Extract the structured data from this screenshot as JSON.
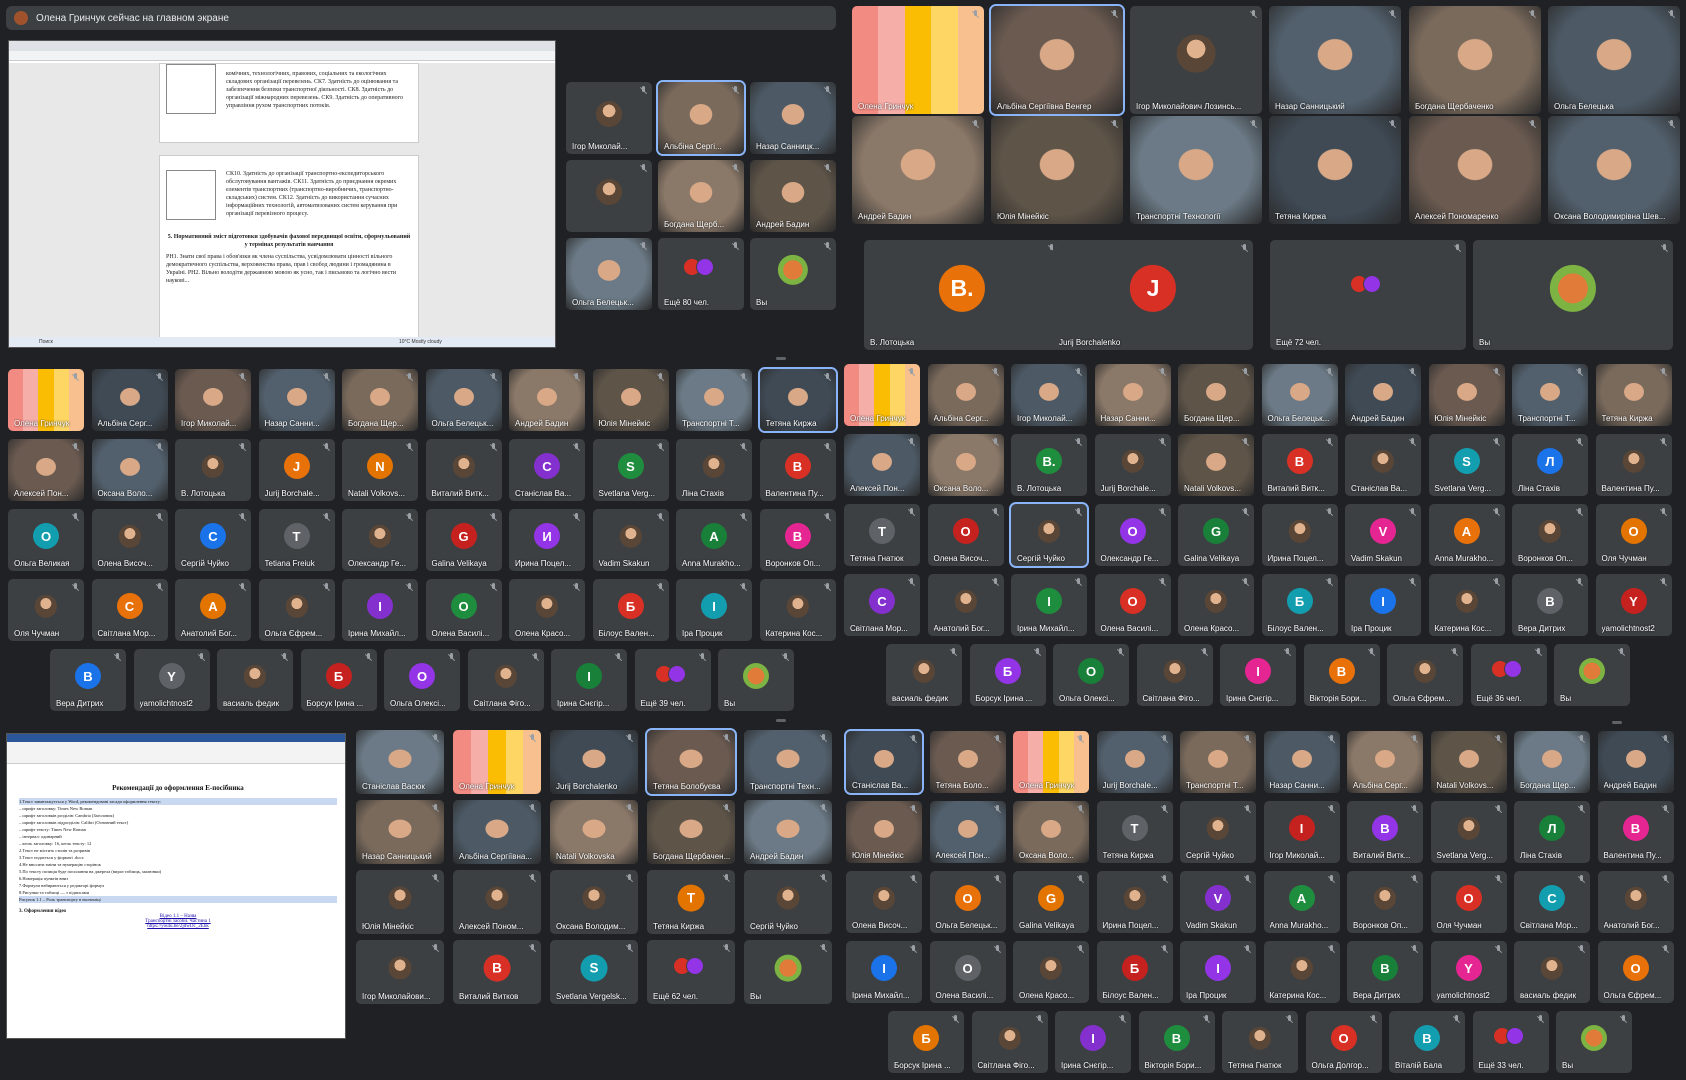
{
  "banner": {
    "text": "Олена Гринчук сейчас на главном экране"
  },
  "doc1": {
    "para1": "комічних, технологічних, правових, соціальних та екологічних складових організації перевезень. СК7. Здатність до оцінювання та забезпечення безпеки транспортної діяльності. СК8. Здатність до організації міжнародних перевезень. СК9. Здатність до оперативного управління рухом транспортних потоків.",
    "para2": "СК10. Здатність до організації транспортно-експедиторського обслуговування вантажів. СК11. Здатність до приєднання окремих елементів транспортних (транспортно-виробничих, транспортно-складських) систем. СК12. Здатність до використання сучасних інформаційних технологій, автоматизованих систем керування при організації перевізного процесу.",
    "heading": "5. Нормативний зміст підготовки здобувачів фахової передвищої освіти, сформульований у термінах результатів навчання",
    "para3": "РН1. Знати свої права і обов'язки як члена суспільства, усвідомлювати цінності вільного демократичного суспільства, верховенства права, прав і свобод людини і громадянина в Україні. РН2. Вільно володіти державною мовою як усно, так і письмово та логічно вести наукові...",
    "tab_label": "Ssfsdf",
    "search_placeholder": "Поиск",
    "weather": "10°C Mostly cloudy"
  },
  "doc2": {
    "title": "Рекомендації до оформлення Е-посібника",
    "lines": [
      "1.Текст завантажується у Word, рекомендовані засади оформлення тексту:",
      "– шрифт заголовку: Times New Roman",
      "– шрифт заголовків розділів: Cambria (Заголовок)",
      "– шрифт заголовків підрозділів: Calibri (Основний текст)",
      "– шрифт тексту: Times New Roman",
      "– інтервал: одинарний",
      "– кегль заголовку: 16, кегль тексту: 12",
      "2.Текст не містить стилів та розривів",
      "3.Текст подається у форматі .docx",
      "4.Не вносити зміни та нумерацію сторінок",
      "5.По тексту позиція буде посилання на джерела (вираз таблиць, малюнки)",
      "6.Номерація пунктів вниз",
      "7.Формули набираються у редакторі формул",
      "8.Рисунки та таблиці — з підписами",
      "Рисунок 1.1 – Роль транспорту в економіці"
    ],
    "footer_line": "3. Оформлення відео",
    "links": [
      "Відео 1.1 – Назва",
      "Транспортні засоби. Частина 1",
      "https://youtu.be/2jdwDc_2Ehk"
    ]
  },
  "grid_top_right": {
    "tiles": [
      "Олена Гринчук",
      "Альбіна Сергіївна Венгер",
      "Ігор Миколайович Лозинсь...",
      "Назар Санницький",
      "Богдана Щербаченко",
      "Ольга Белецька",
      "Андрей Бадин",
      "Юлія Мінейкіс",
      "Транспортні Технології",
      "Тетяна Киржа",
      "Алексей Пономаренко",
      "Оксана Володимирівна Шев...",
      "В. Лотоцька",
      "Jurij Borchalenko",
      "Ещё 72 чел.",
      "Вы"
    ],
    "letters": [
      "В.",
      "J",
      "В"
    ]
  },
  "grid_mid_small": {
    "tiles": [
      "Ігор Миколай...",
      "Альбіна Сергі...",
      "Назар Санницк...",
      "Богдана Щерб...",
      "Андрей Бадин",
      "Ольга Белецьк...",
      "Ещё 80 чел.",
      "Вы"
    ]
  },
  "grid_mid_left": {
    "rows": [
      [
        "Олена Гринчук",
        "Альбіна Серг...",
        "Ігор Миколай...",
        "Назар Санни...",
        "Богдана Щер...",
        "Ольга Белецьк...",
        "Андрей Бадин",
        "Юлія Мінейкіс",
        "Транспортні Т...",
        "Тетяна Киржа"
      ],
      [
        "Алексей Пон...",
        "Оксана Воло...",
        "В. Лотоцька",
        "Jurij Borchale...",
        "Natali Volkovs...",
        "Виталий Витк...",
        "Станіслав Ва...",
        "Svetlana Verg...",
        "Ліна Стахів",
        "Валентина Пу..."
      ],
      [
        "Ольга Великая",
        "Олена Височ...",
        "Сергій Чуйко",
        "Tetiana Freiuk",
        "Олександр Ге...",
        "Galina Velikaya",
        "Ирина Поцел...",
        "Vadim Skakun",
        "Anna Murakho...",
        "Воронков Оп..."
      ],
      [
        "Оля Чучман",
        "Світлана Мор...",
        "Анатолий Бог...",
        "Ольга Єфрем...",
        "Ірина Михайл...",
        "Олена Василі...",
        "Олена Красо...",
        "Білоус Вален...",
        "Іра Процик",
        "Катерина Кос..."
      ],
      [
        "Вера Дитрих",
        "yamolichtnost2",
        "васиаль федик",
        "Борсук Ірина ...",
        "Ольга Олексі...",
        "Світлана Фіго...",
        "Ірина Снєгір...",
        "Ещё 39 чел.",
        "Вы"
      ]
    ],
    "letters": [
      "В.",
      "J",
      "В",
      "S",
      "Л",
      "В",
      "О",
      "О",
      "G",
      "И",
      "А",
      "О",
      "А",
      "О",
      "О",
      "Б",
      "К",
      "В",
      "Б",
      "І",
      "Л",
      "В"
    ]
  },
  "grid_mid_right": {
    "rows": [
      [
        "Олена Гринчук",
        "Альбіна Серг...",
        "Ігор Миколай...",
        "Назар Санни...",
        "Богдана Щер...",
        "Ольга Белецьк...",
        "Андрей Бадин",
        "Юлія Мінейкіс",
        "Транспортні Т...",
        "Тетяна Киржа"
      ],
      [
        "Алексей Пон...",
        "Оксана Воло...",
        "В. Лотоцька",
        "Jurij Borchale...",
        "Natali Volkovs...",
        "Виталий Витк...",
        "Станіслав Ва...",
        "Svetlana Verg...",
        "Ліна Стахів",
        "Валентина Пу..."
      ],
      [
        "Тетяна Гнатюк",
        "Олена Височ...",
        "Сергій Чуйко",
        "Олександр Ге...",
        "Galina Velikaya",
        "Ирина Поцел...",
        "Vadim Skakun",
        "Anna Murakho...",
        "Воронков Оп...",
        "Оля Чучман"
      ],
      [
        "Світлана Мор...",
        "Анатолий Бог...",
        "Ірина Михайл...",
        "Олена Василі...",
        "Олена Красо...",
        "Білоус Вален...",
        "Іра Процик",
        "Катерина Кос...",
        "Вера Дитрих",
        "yamolichtnost2"
      ],
      [
        "васиаль федик",
        "Борсук Ірина ...",
        "Ольга Олексі...",
        "Світлана Фіго...",
        "Ірина Снєгір...",
        "Вікторія Бори...",
        "Ольга Єфрем...",
        "Ещё 36 чел.",
        "Вы"
      ]
    ]
  },
  "grid_bot_mid": {
    "tiles": [
      "Станіслав Васюк",
      "Олена Гринчук",
      "Jurij Borchalenko",
      "Тетяна Болобуєва",
      "Транспортні Техн...",
      "Назар Санницький",
      "Альбіна Сергіївна...",
      "Natali Volkovska",
      "Богдана Щербачен...",
      "Андрей Бадин",
      "Юлія Мінейкіс",
      "Алексей Поном...",
      "Оксана Володим...",
      "Тетяна Киржа",
      "Сергій Чуйко",
      "Ігор Миколайови...",
      "Виталий Витков",
      "Svetlana Vergelsk...",
      "Ещё 62 чел.",
      "Вы"
    ],
    "letters": [
      "Т",
      "В",
      "S",
      "Л",
      "В"
    ]
  },
  "grid_bot_right": {
    "rows": [
      [
        "Станіслав Ва...",
        "Тетяна Боло...",
        "Олена Гринчук",
        "Jurij Borchale...",
        "Транспортні Т...",
        "Назар Санни...",
        "Альбіна Серг...",
        "Natali Volkovs...",
        "Богдана Щер...",
        "Андрей Бадин"
      ],
      [
        "Юлія Мінейкіс",
        "Алексей Пон...",
        "Оксана Воло...",
        "Тетяна Киржа",
        "Сергій Чуйко",
        "Ігор Миколай...",
        "Виталий Витк...",
        "Svetlana Verg...",
        "Ліна Стахів",
        "Валентина Пу..."
      ],
      [
        "Олена Височ...",
        "Ольга Белецьк...",
        "Galina Velikaya",
        "Ирина Поцел...",
        "Vadim Skakun",
        "Anna Murakho...",
        "Воронков Оп...",
        "Оля Чучман",
        "Світлана Мор...",
        "Анатолий Бог..."
      ],
      [
        "Ірина Михайл...",
        "Олена Василі...",
        "Олена Красо...",
        "Білоус Вален...",
        "Іра Процик",
        "Катерина Кос...",
        "Вера Дитрих",
        "yamolichtnost2",
        "васиаль федик",
        "Ольга Єфрем..."
      ],
      [
        "Борсук Ірина ...",
        "Світлана Фіго...",
        "Ірина Снєгір...",
        "Вікторія Бори...",
        "Тетяна Гнатюк",
        "Ольга Долгор...",
        "Віталій Бала",
        "Ещё 33 чел.",
        "Вы"
      ]
    ]
  },
  "colors": {
    "bg": "#202124",
    "tile": "#3c4043",
    "speaking": "#8ab4f8"
  }
}
